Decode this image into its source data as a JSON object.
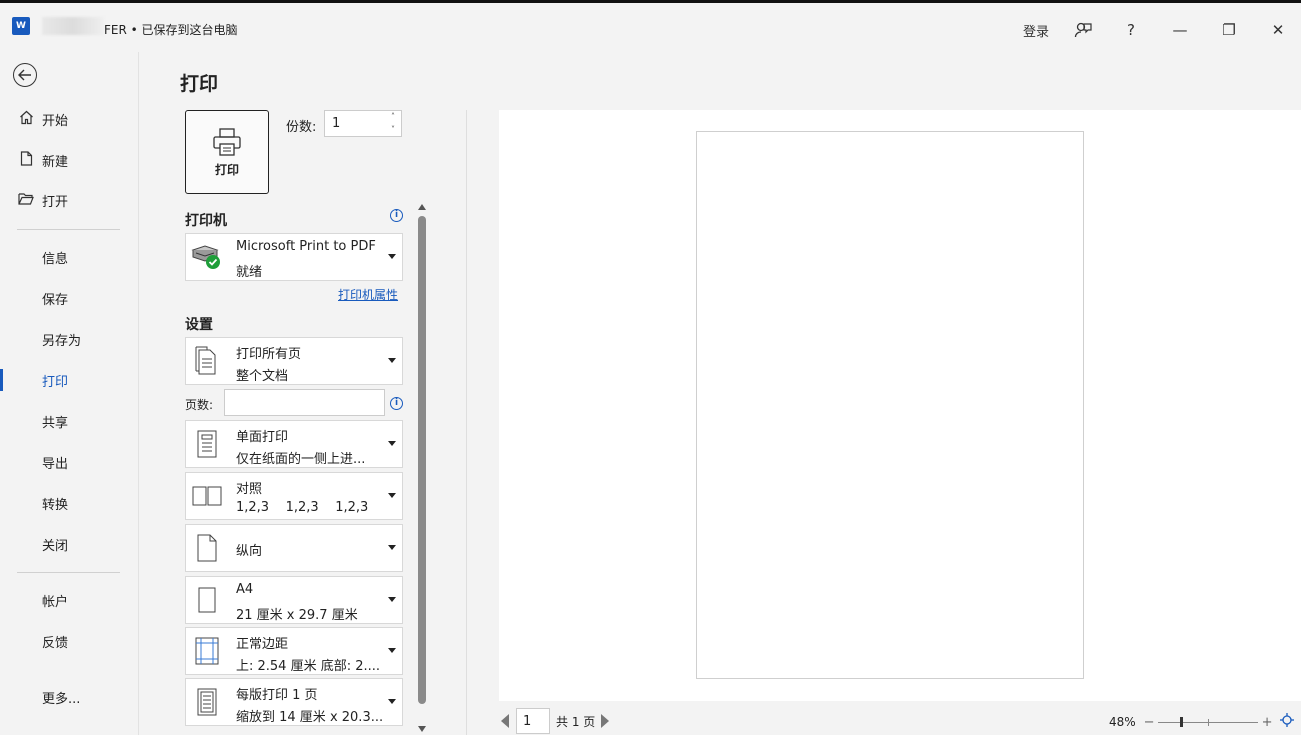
{
  "titlebar": {
    "app_icon_letter": "W",
    "title": "FER • 已保存到这台电脑",
    "login_label": "登录",
    "coauthor_icon": "person-feedback-icon",
    "help_label": "?",
    "minimize_label": "—",
    "restore_label": "❐",
    "close_label": "✕"
  },
  "nav": {
    "back_icon": "back-arrow-icon",
    "items": [
      {
        "label": "开始",
        "icon": "home-icon"
      },
      {
        "label": "新建",
        "icon": "new-doc-icon"
      },
      {
        "label": "打开",
        "icon": "open-folder-icon"
      },
      {
        "label": "信息"
      },
      {
        "label": "保存"
      },
      {
        "label": "另存为"
      },
      {
        "label": "打印"
      },
      {
        "label": "共享"
      },
      {
        "label": "导出"
      },
      {
        "label": "转换"
      },
      {
        "label": "关闭"
      },
      {
        "label": "帐户"
      },
      {
        "label": "反馈"
      },
      {
        "label": "更多..."
      }
    ]
  },
  "print": {
    "page_title": "打印",
    "print_button_label": "打印",
    "copies_label": "份数:",
    "copies_value": "1",
    "spinner_up": "˄",
    "spinner_down": "˅",
    "printer_section": "打印机",
    "printer_name": "Microsoft Print to PDF",
    "printer_status": "就绪",
    "printer_properties_link": "打印机属性",
    "settings_section": "设置",
    "info_glyph": "i",
    "pages_label": "页数:",
    "pages_value": "",
    "settings": [
      {
        "line1": "打印所有页",
        "line2": "整个文档"
      },
      {
        "line1": "单面打印",
        "line2": "仅在纸面的一侧上进..."
      },
      {
        "line1": "对照",
        "line2": "1,2,3    1,2,3    1,2,3"
      },
      {
        "line1": "纵向",
        "line2": ""
      },
      {
        "line1": "A4",
        "line2": "21 厘米 x 29.7 厘米"
      },
      {
        "line1": "正常边距",
        "line2": "上: 2.54 厘米 底部: 2...."
      },
      {
        "line1": "每版打印 1 页",
        "line2": "缩放到 14 厘米 x 20.3..."
      }
    ]
  },
  "preview": {
    "current_page": "1",
    "total_pages": "共 1 页",
    "zoom_label": "48%",
    "zoom_level": 0.48,
    "zoom_minus": "−",
    "zoom_plus": "+",
    "fit_icon": "fit-to-window-icon"
  },
  "colors": {
    "accent": "#185abd",
    "printer_ok": "#1f9e3a"
  }
}
